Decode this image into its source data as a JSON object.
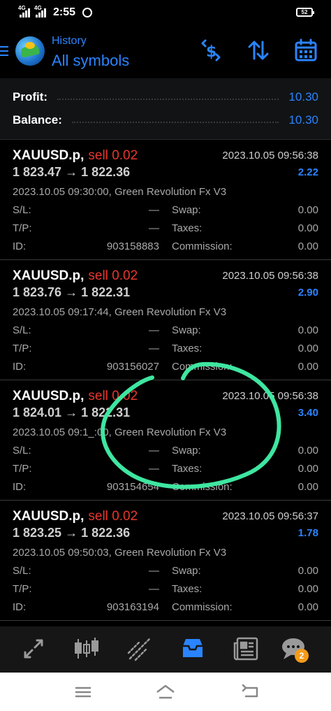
{
  "status_bar": {
    "network_1": "4G",
    "network_2": "4G",
    "time": "2:55",
    "battery": "52"
  },
  "header": {
    "subtitle": "History",
    "title": "All symbols",
    "icons": [
      "currency-exchange-icon",
      "sort-icon",
      "calendar-icon"
    ]
  },
  "summary": {
    "profit_label": "Profit:",
    "profit_value": "10.30",
    "balance_label": "Balance:",
    "balance_value": "10.30"
  },
  "trades": [
    {
      "symbol": "XAUUSD.p,",
      "type": "sell 0.02",
      "close_time": "2023.10.05 09:56:38",
      "prices": "1 823.47 → 1 822.36",
      "profit": "2.22",
      "open_info": "2023.10.05 09:30:00, Green Revolution Fx V3",
      "sl_label": "S/L:",
      "sl": "—",
      "tp_label": "T/P:",
      "tp": "—",
      "id_label": "ID:",
      "id": "903158883",
      "swap_label": "Swap:",
      "swap": "0.00",
      "taxes_label": "Taxes:",
      "taxes": "0.00",
      "commission_label": "Commission:",
      "commission": "0.00"
    },
    {
      "symbol": "XAUUSD.p,",
      "type": "sell 0.02",
      "close_time": "2023.10.05 09:56:38",
      "prices": "1 823.76 → 1 822.31",
      "profit": "2.90",
      "open_info": "2023.10.05 09:17:44, Green Revolution Fx V3",
      "sl_label": "S/L:",
      "sl": "—",
      "tp_label": "T/P:",
      "tp": "—",
      "id_label": "ID:",
      "id": "903156027",
      "swap_label": "Swap:",
      "swap": "0.00",
      "taxes_label": "Taxes:",
      "taxes": "0.00",
      "commission_label": "Commission:",
      "commission": "0.00"
    },
    {
      "symbol": "XAUUSD.p,",
      "type": "sell 0.02",
      "close_time": "2023.10.05 09:56:38",
      "prices": "1 824.01 → 1 822.31",
      "profit": "3.40",
      "open_info": "2023.10.05 09:1_:00, Green Revolution Fx V3",
      "sl_label": "S/L:",
      "sl": "—",
      "tp_label": "T/P:",
      "tp": "—",
      "id_label": "ID:",
      "id": "903154654",
      "swap_label": "Swap:",
      "swap": "0.00",
      "taxes_label": "Taxes:",
      "taxes": "0.00",
      "commission_label": "Commission:",
      "commission": "0.00"
    },
    {
      "symbol": "XAUUSD.p,",
      "type": "sell 0.02",
      "close_time": "2023.10.05 09:56:37",
      "prices": "1 823.25 → 1 822.36",
      "profit": "1.78",
      "open_info": "2023.10.05 09:50:03, Green Revolution Fx V3",
      "sl_label": "S/L:",
      "sl": "—",
      "tp_label": "T/P:",
      "tp": "—",
      "id_label": "ID:",
      "id": "903163194",
      "swap_label": "Swap:",
      "swap": "0.00",
      "taxes_label": "Taxes:",
      "taxes": "0.00",
      "commission_label": "Commission:",
      "commission": "0.00"
    }
  ],
  "bottom_nav": {
    "items": [
      "quotes-icon",
      "chart-icon",
      "trade-icon",
      "history-icon",
      "news-icon",
      "messages-icon"
    ],
    "active": "history-icon",
    "messages_badge": "2"
  },
  "colors": {
    "accent": "#2a84ff",
    "sell": "#e8372c",
    "annotation": "#3ee6a0"
  }
}
